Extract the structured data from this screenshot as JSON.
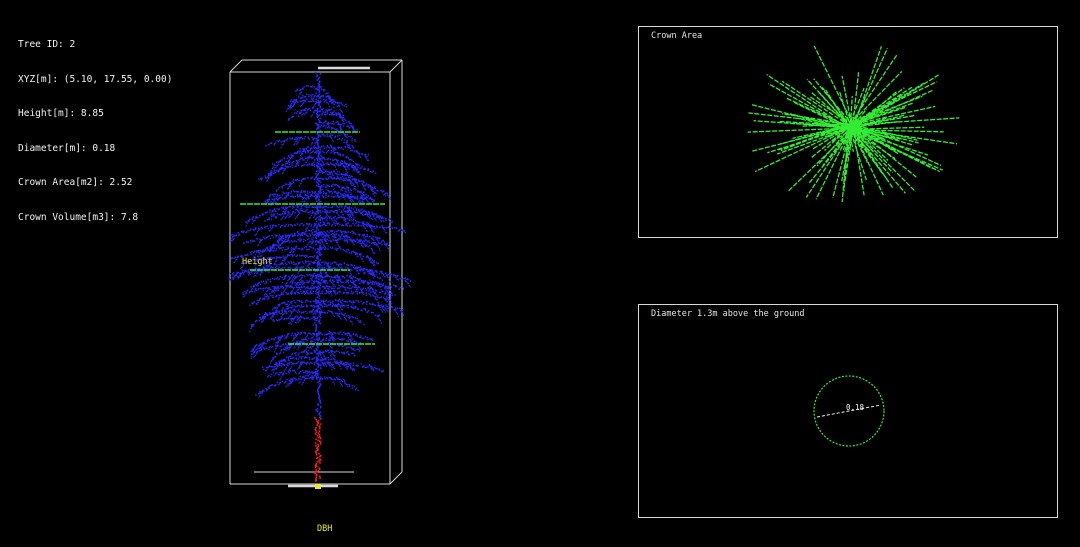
{
  "info": {
    "tree_id": "Tree ID: 2",
    "xyz": "XYZ[m]: (5.10, 17.55, 0.00)",
    "height": "Height[m]: 8.85",
    "diameter": "Diameter[m]: 0.18",
    "crown_area": "Crown Area[m2]: 2.52",
    "crown_volume": "Crown Volume[m3]: 7.8"
  },
  "tree_view": {
    "height_label": "Height",
    "axis_label": "DBH"
  },
  "crown_panel": {
    "title": "Crown Area"
  },
  "dbh_panel": {
    "title": "Diameter 1.3m above the ground",
    "value": "0.18"
  },
  "colors": {
    "stem": "#ff2020",
    "crown_points": "#2a2aff",
    "slices": "#33ee33",
    "labels": "#e8e830",
    "frame": "#d8d8d8"
  }
}
